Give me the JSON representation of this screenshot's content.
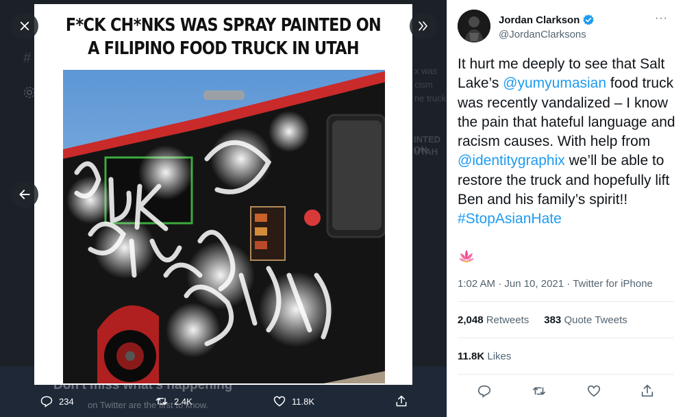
{
  "viewer": {
    "background_hints": [
      "#",
      "x was",
      "cism",
      "ne truck",
      "INTED ON",
      "UTAH",
      "Don't miss what's happening",
      "on Twitter are the first to know."
    ],
    "headline_line1": "F*CK CH*NKS WAS SPRAY PAINTED ON",
    "headline_line2": "A FILIPINO FOOD TRUCK IN UTAH",
    "photo_alt": "Black food truck vandalized with white spray paint",
    "actions": {
      "replies": "234",
      "retweets": "2.4K",
      "likes": "11.8K"
    }
  },
  "tweet": {
    "author_name": "Jordan Clarkson",
    "author_handle": "@JordanClarksons",
    "more_label": "···",
    "text_parts": {
      "p1": "It hurt me deeply to see that Salt Lake’s ",
      "mention1": "@yumyumasian",
      "p2": " food truck was recently vandalized – I know the pain that hateful language and racism causes. With help from ",
      "mention2": "@identitygraphix",
      "p3": " we’ll be able to restore the truck and hopefully lift Ben and his family’s spirit!! ",
      "hashtag": "#StopAsianHate"
    },
    "timestamp": "1:02 AM · Jun 10, 2021 · Twitter for iPhone",
    "retweets_count": "2,048",
    "retweets_label": "Retweets",
    "quote_count": "383",
    "quote_label": "Quote Tweets",
    "likes_count": "11.8K",
    "likes_label": "Likes"
  },
  "colors": {
    "link": "#1d9bf0",
    "text": "#0f1419",
    "muted": "#536471",
    "viewer_bg": "#1c2127"
  },
  "icons": [
    "close-icon",
    "expand-icon",
    "back-arrow-icon",
    "reply-icon",
    "retweet-icon",
    "like-icon",
    "share-icon",
    "verified-icon",
    "lotus-emoji-icon",
    "more-icon"
  ]
}
